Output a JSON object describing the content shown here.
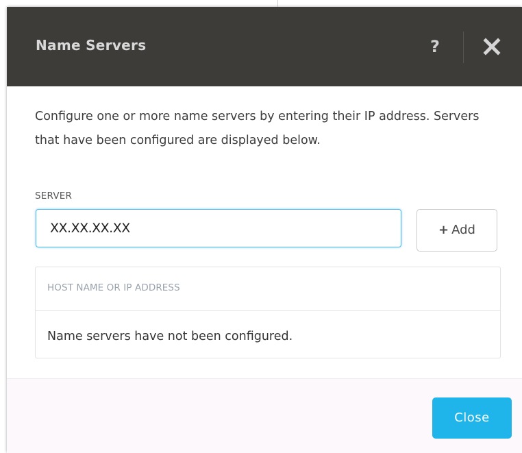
{
  "dialog": {
    "title": "Name Servers",
    "help_label": "?",
    "close_icon": "close-icon",
    "description": "Configure one or more name servers by entering their IP address. Servers that have been configured are displayed below.",
    "server": {
      "label": "SERVER",
      "value": "XX.XX.XX.XX",
      "add_label": "Add",
      "add_icon": "plus-icon"
    },
    "table": {
      "header": "HOST NAME OR IP ADDRESS",
      "empty_message": "Name servers have not been configured."
    },
    "footer": {
      "close_label": "Close"
    }
  },
  "colors": {
    "header_bg": "#3d3c39",
    "accent": "#1fb5ea",
    "input_focus": "#4db8ec",
    "footer_bg": "#fdf8fb"
  }
}
